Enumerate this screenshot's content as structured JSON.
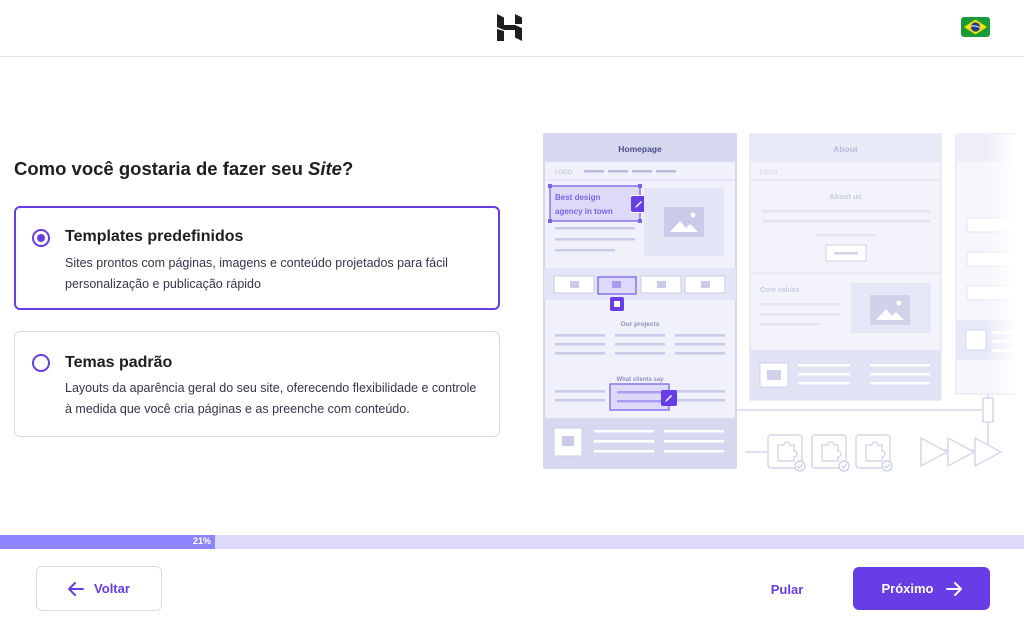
{
  "header": {
    "logo_icon": "hostinger-logo-icon",
    "language_flag_icon": "brazil-flag-icon"
  },
  "question": {
    "prefix": "Como você gostaria de fazer seu ",
    "emphasis": "Site",
    "suffix": "?"
  },
  "options": [
    {
      "title": "Templates predefinidos",
      "description": "Sites prontos com páginas, imagens e conteúdo projetados para fácil personalização e publicação rápido",
      "selected": true
    },
    {
      "title": "Temas padrão",
      "description": "Layouts da aparência geral do seu site, oferecendo flexibilidade e controle à medida que você cria páginas e as preenche com conteúdo.",
      "selected": false
    }
  ],
  "illustration": {
    "homepage_title": "Homepage",
    "about_title": "About",
    "logo_text": "LOGO",
    "hero_text_line1": "Best design",
    "hero_text_line2": "agency in town",
    "about_us": "About us",
    "core_values": "Core values",
    "our_projects": "Our projects",
    "what_clients_say": "What clients say"
  },
  "progress": {
    "value": 0.21,
    "label": "21%"
  },
  "footer": {
    "back_label": "Voltar",
    "skip_label": "Pular",
    "next_label": "Próximo"
  },
  "colors": {
    "accent": "#673de6",
    "progress_track": "#ddd9fb",
    "progress_fill": "#8c85ff",
    "illustration_fill": "#dadcf0",
    "illustration_stroke": "#c7cae8"
  }
}
